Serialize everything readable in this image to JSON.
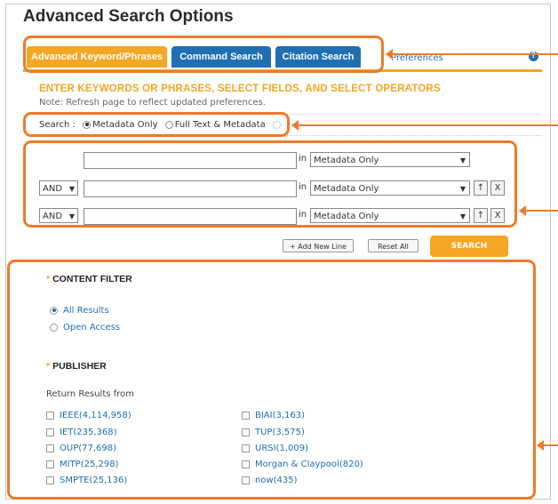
{
  "page": {
    "title": "Advanced Search Options"
  },
  "tabs": [
    {
      "label": "Advanced Keyword/Phrases",
      "active": true
    },
    {
      "label": "Command Search",
      "active": false
    },
    {
      "label": "Citation Search",
      "active": false
    }
  ],
  "preferences_label": "Preferences",
  "help_icon": "?",
  "instructions": "ENTER KEYWORDS OR PHRASES, SELECT FIELDS, AND SELECT OPERATORS",
  "note": "Note: Refresh page to reflect updated preferences.",
  "search_scope": {
    "label": "Search :",
    "options": [
      "Metadata Only",
      "Full Text & Metadata"
    ],
    "selected": "Metadata Only"
  },
  "query_rows": [
    {
      "operator": "",
      "keyword": "",
      "in_label": "in",
      "field": "Metadata Only"
    },
    {
      "operator": "AND",
      "keyword": "",
      "in_label": "in",
      "field": "Metadata Only"
    },
    {
      "operator": "AND",
      "keyword": "",
      "in_label": "in",
      "field": "Metadata Only"
    }
  ],
  "row_buttons": {
    "up": "↑",
    "remove": "X"
  },
  "actions": {
    "add_line": "Add New Line",
    "reset": "Reset All",
    "search": "SEARCH"
  },
  "content_filter": {
    "heading": "CONTENT FILTER",
    "options": [
      "All Results",
      "Open Access"
    ],
    "selected": "All Results"
  },
  "publisher": {
    "heading": "PUBLISHER",
    "return_label": "Return Results from",
    "left": [
      "IEEE(4,114,958)",
      "IET(235,368)",
      "OUP(77,698)",
      "MITP(25,298)",
      "SMPTE(25,136)"
    ],
    "right": [
      "BIAI(3,163)",
      "TUP(3,575)",
      "URSI(1,009)",
      "Morgan & Claypool(820)",
      "now(435)"
    ]
  },
  "colors": {
    "accent": "#f5a623",
    "tab_blue": "#1f6fb2",
    "highlight": "#ee7a2d",
    "link": "#1f6fb2"
  }
}
